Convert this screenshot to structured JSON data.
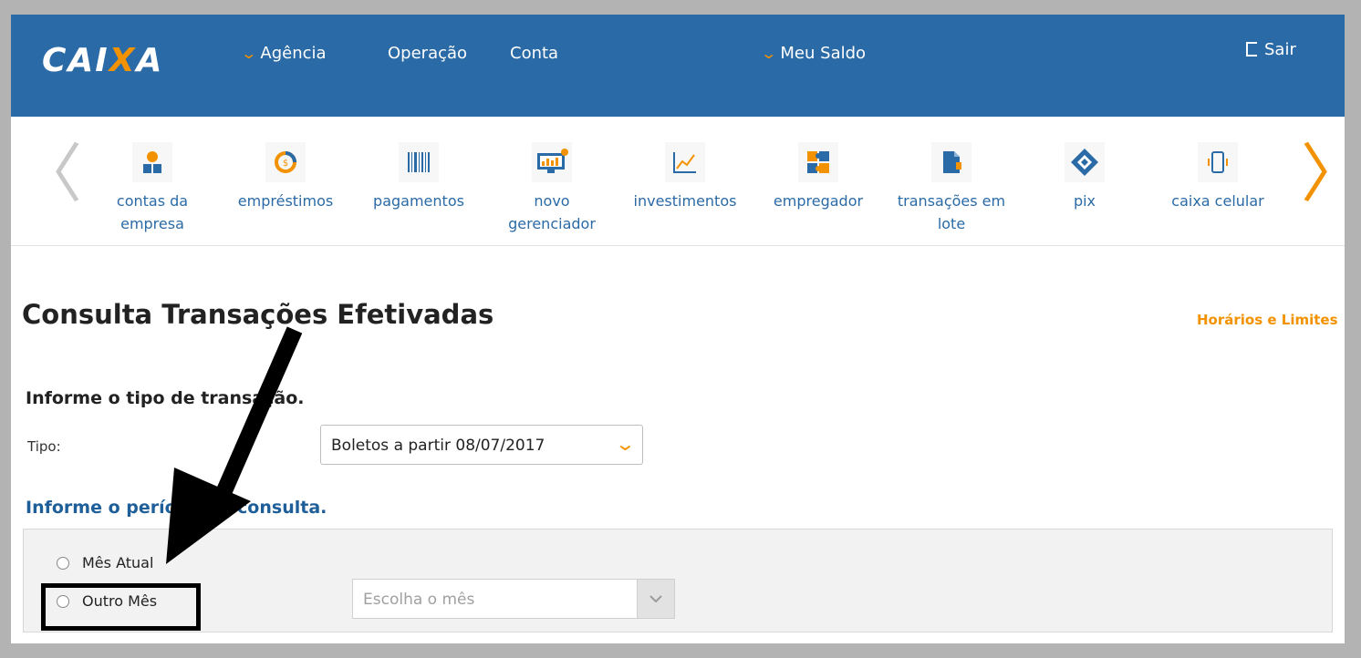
{
  "header": {
    "logo": "CAIXA",
    "nav": [
      {
        "label": "Agência",
        "has_dropdown": true
      },
      {
        "label": "Operação",
        "has_dropdown": false
      },
      {
        "label": "Conta",
        "has_dropdown": false
      }
    ],
    "balance_label": "Meu Saldo",
    "logout_label": "Sair"
  },
  "carousel": {
    "items": [
      {
        "label": "contas da empresa",
        "icon": "users-icon"
      },
      {
        "label": "empréstimos",
        "icon": "coin-icon"
      },
      {
        "label": "pagamentos",
        "icon": "barcode-icon"
      },
      {
        "label": "novo gerenciador",
        "icon": "monitor-chart-icon"
      },
      {
        "label": "investimentos",
        "icon": "line-chart-icon"
      },
      {
        "label": "empregador",
        "icon": "puzzle-icon"
      },
      {
        "label": "transações em lote",
        "icon": "document-icon"
      },
      {
        "label": "pix",
        "icon": "pix-icon"
      },
      {
        "label": "caixa celular",
        "icon": "phone-icon"
      }
    ]
  },
  "page": {
    "title": "Consulta Transações Efetivadas",
    "limits_link": "Horários e Limites",
    "type_heading": "Informe o tipo de transação.",
    "tipo_label": "Tipo:",
    "tipo_value": "Boletos a partir 08/07/2017",
    "period_heading": "Informe o período de consulta.",
    "radio_current": "Mês Atual",
    "radio_other": "Outro Mês",
    "month_placeholder": "Escolha o mês"
  },
  "colors": {
    "header_blue": "#2a6aa6",
    "accent_orange": "#f39200"
  }
}
